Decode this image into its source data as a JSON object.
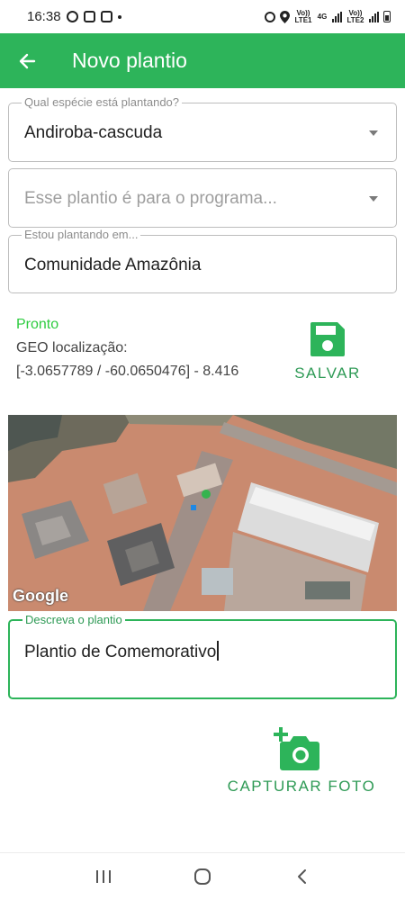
{
  "status_bar": {
    "time": "16:38",
    "sim1_label": "Vo)) LTE1",
    "sim2_label": "Vo)) LTE2",
    "net_label": "4G",
    "icons": [
      "whatsapp-icon",
      "gallery-icon",
      "instagram-icon",
      "dot-icon",
      "alarm-icon",
      "location-icon",
      "signal-icon",
      "battery-icon"
    ]
  },
  "app_bar": {
    "title": "Novo plantio",
    "back_icon": "arrow-left-icon",
    "color": "#2db45a"
  },
  "form": {
    "species": {
      "legend": "Qual espécie está plantando?",
      "value": "Andiroba-cascuda"
    },
    "program": {
      "placeholder": "Esse plantio é para o programa..."
    },
    "location": {
      "legend": "Estou plantando em...",
      "value": "Comunidade Amazônia"
    },
    "description": {
      "legend": "Descreva o plantio",
      "value": "Plantio de Comemorativo"
    }
  },
  "status": {
    "state": "Pronto",
    "geo_label": "GEO localização:",
    "geo_value": "[-3.0657789 / -60.0650476] - 8.416",
    "ready_color": "#2ecc40"
  },
  "actions": {
    "save_label": "SALVAR",
    "capture_label": "CAPTURAR FOTO",
    "accent": "#2e9a55"
  },
  "map": {
    "attribution": "Google"
  },
  "nav_bar": {
    "recents": "|||",
    "home": "○",
    "back": "‹"
  }
}
